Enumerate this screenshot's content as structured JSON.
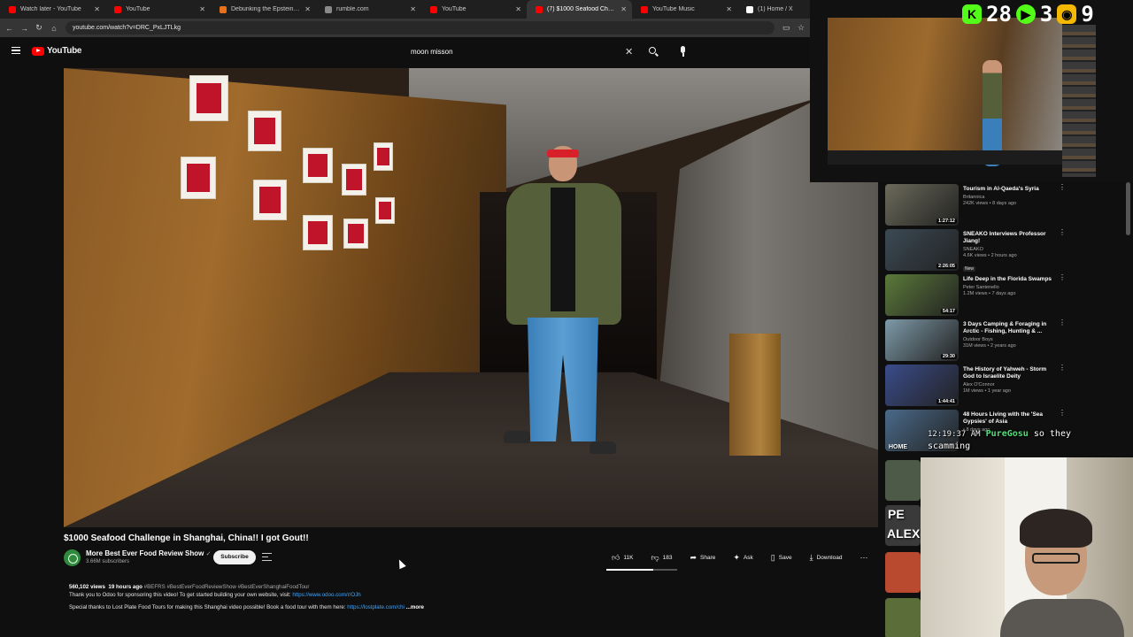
{
  "browser": {
    "tabs": [
      {
        "label": "Watch later - YouTube",
        "color": "#ff0000",
        "active": false
      },
      {
        "label": "YouTube",
        "color": "#ff0000",
        "active": false
      },
      {
        "label": "Debunking the Epstein My",
        "color": "#e8711c",
        "active": false
      },
      {
        "label": "rumble.com",
        "color": "#8a8a8a",
        "active": false
      },
      {
        "label": "YouTube",
        "color": "#ff0000",
        "active": false
      },
      {
        "label": "(7) $1000 Seafood Challeng",
        "color": "#ff0000",
        "active": true
      },
      {
        "label": "YouTube Music",
        "color": "#ff0000",
        "active": false
      },
      {
        "label": "(1) Home / X",
        "color": "#ffffff",
        "active": false
      }
    ],
    "url": "youtube.com/watch?v=DRC_PxLJTLkg"
  },
  "youtube": {
    "logo_text": "YouTube",
    "search_value": "moon misson"
  },
  "video": {
    "title": "$1000 Seafood Challenge in Shanghai, China!! I got Gout!!",
    "channel": "More Best Ever Food Review Show",
    "subscribers": "3.66M subscribers",
    "subscribe_label": "Subscribe",
    "likes": "11K",
    "dislikes": "183",
    "like_ratio": 0.66,
    "share_label": "Share",
    "ask_label": "Ask",
    "save_label": "Save",
    "download_label": "Download"
  },
  "description": {
    "views": "560,102 views",
    "age": "19 hours ago",
    "tags": "#BEFRS #BestEverFoodReviewShow #BestEverShanghaiFoodTour",
    "line1": "Thank you to Odoo for sponsoring this video! To get started building your own website, visit:",
    "link1": "https://www.odoo.com/r/OJh",
    "line2": "Special thanks to Lost Plate Food Tours for making this Shanghai video possible! Book a food tour with them here:",
    "link2": "https://lostplate.com/chi",
    "more": "...more"
  },
  "sidebar": {
    "items": [
      {
        "title": "Tourism in Al-Qaeda's Syria",
        "channel": "Britannica",
        "meta": "242K views • 8 days ago",
        "duration": "1:27:12",
        "new": "",
        "color": "#6b6a5a"
      },
      {
        "title": "SNEAKO Interviews Professor Jiang!",
        "channel": "SNEAKO",
        "meta": "4.6K views • 2 hours ago",
        "duration": "2:26:05",
        "new": "New",
        "color": "#3b4a55"
      },
      {
        "title": "Life Deep in the Florida Swamps",
        "channel": "Peter Santenello",
        "meta": "1.2M views • 7 days ago",
        "duration": "54:17",
        "new": "",
        "color": "#5b7a3a"
      },
      {
        "title": "3 Days Camping & Foraging in Arctic - Fishing, Hunting & ...",
        "channel": "Outdoor Boys",
        "meta": "31M views • 2 years ago",
        "duration": "29:30",
        "new": "",
        "color": "#7e9aa8"
      },
      {
        "title": "The History of Yahweh - Storm God to Israelite Deity",
        "channel": "Alex O'Connor",
        "meta": "1M views • 1 year ago",
        "duration": "1:44:41",
        "new": "",
        "color": "#3a4c8a"
      },
      {
        "title": "48 Hours Living with the 'Sea Gypsies' of Asia",
        "channel": "",
        "meta": "• 8 days ago",
        "duration": "",
        "new": "",
        "color": "#4a6a8a"
      }
    ]
  },
  "overlay": {
    "score1": "28",
    "score2": "3",
    "score3": "9",
    "chat_time": "12:19:37 AM",
    "chat_user": "PureGosu",
    "chat_text": "so they",
    "chat_text2": "scamming",
    "home_label": "HOME",
    "thumb_text1": "ALEX",
    "thumb_text2": "PE"
  }
}
